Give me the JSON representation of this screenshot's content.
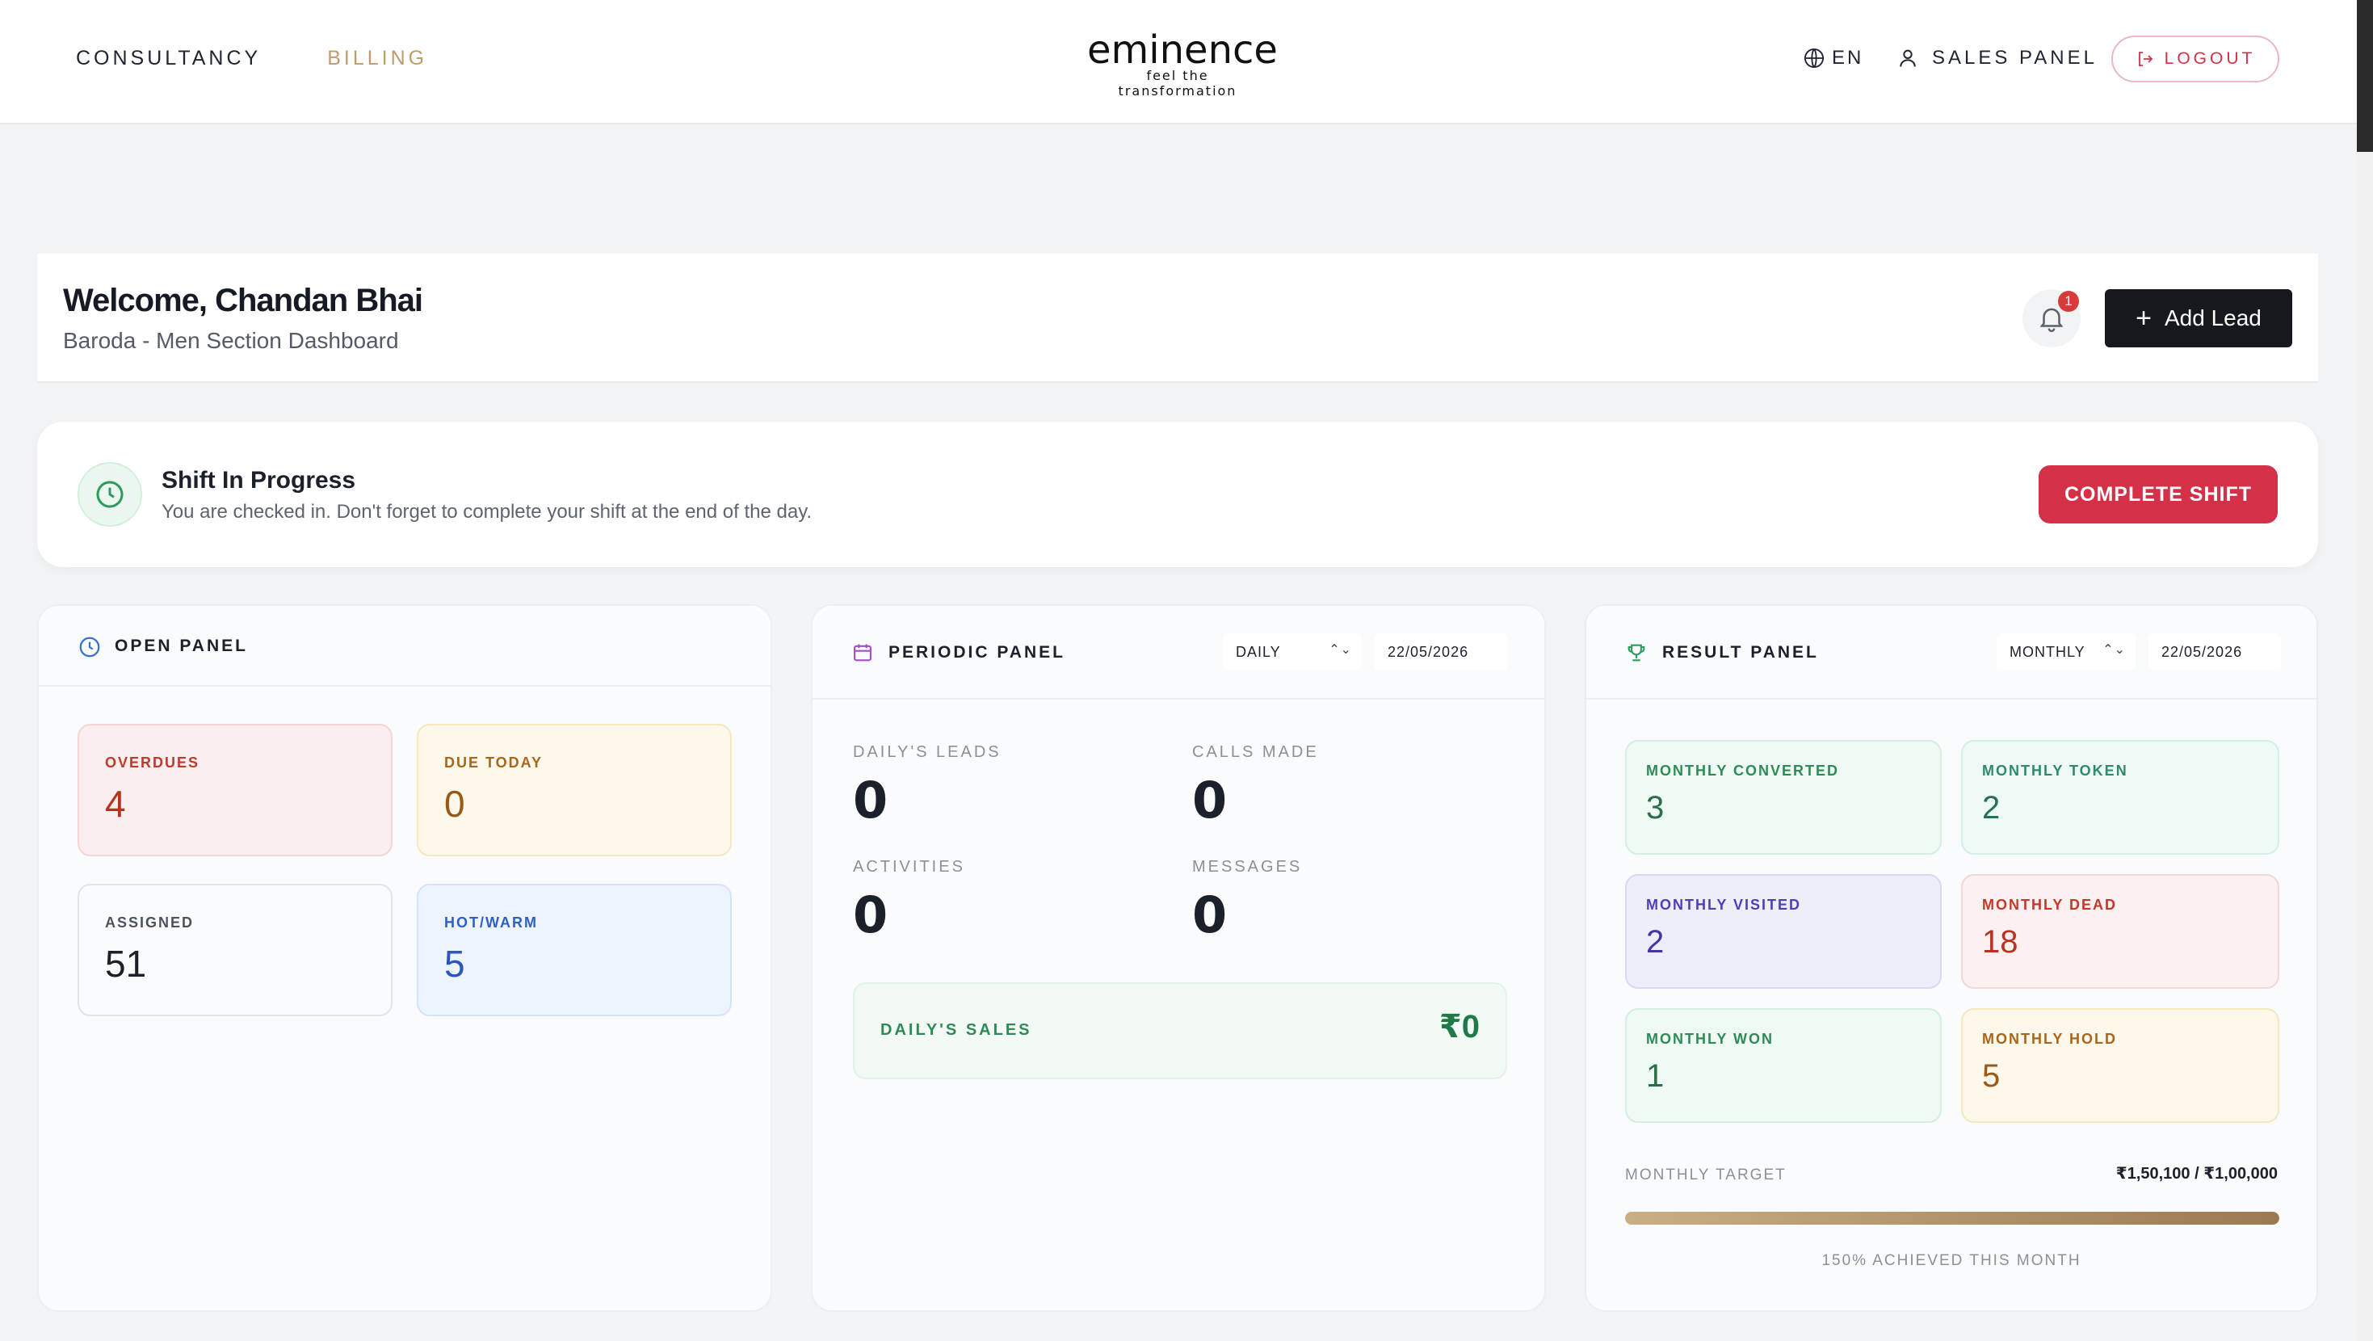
{
  "nav": {
    "links": [
      "CONSULTANCY",
      "BILLING"
    ],
    "brand_name": "eminence",
    "brand_tagline": "feel the transformation",
    "lang": "EN",
    "sales_panel": "SALES PANEL",
    "logout": "LOGOUT"
  },
  "welcome": {
    "title": "Welcome, Chandan Bhai",
    "subtitle": "Baroda - Men Section Dashboard",
    "notification_count": "1",
    "add_lead": "Add Lead"
  },
  "shift": {
    "title": "Shift In Progress",
    "message": "You are checked in. Don't forget to complete your shift at the end of the day.",
    "button": "COMPLETE SHIFT"
  },
  "open_panel": {
    "title": "OPEN PANEL",
    "cards": [
      {
        "label": "OVERDUES",
        "value": "4"
      },
      {
        "label": "DUE TODAY",
        "value": "0"
      },
      {
        "label": "ASSIGNED",
        "value": "51"
      },
      {
        "label": "HOT/WARM",
        "value": "5"
      }
    ]
  },
  "periodic_panel": {
    "title": "PERIODIC PANEL",
    "period": "DAILY",
    "date": "22/05/2026",
    "stats": [
      {
        "label": "DAILY'S LEADS",
        "value": "0"
      },
      {
        "label": "CALLS MADE",
        "value": "0"
      },
      {
        "label": "ACTIVITIES",
        "value": "0"
      },
      {
        "label": "MESSAGES",
        "value": "0"
      }
    ],
    "sales_label": "DAILY'S SALES",
    "sales_value": "₹0"
  },
  "result_panel": {
    "title": "RESULT PANEL",
    "period": "MONTHLY",
    "date": "22/05/2026",
    "cards": [
      {
        "label": "MONTHLY CONVERTED",
        "value": "3"
      },
      {
        "label": "MONTHLY TOKEN",
        "value": "2"
      },
      {
        "label": "MONTHLY VISITED",
        "value": "2"
      },
      {
        "label": "MONTHLY DEAD",
        "value": "18"
      },
      {
        "label": "MONTHLY WON",
        "value": "1"
      },
      {
        "label": "MONTHLY HOLD",
        "value": "5"
      }
    ],
    "target_label": "MONTHLY TARGET",
    "target_value": "₹1,50,100 / ₹1,00,000",
    "target_progress": 1.0,
    "achieved_text": "150% ACHIEVED THIS MONTH"
  },
  "colors": {
    "accent_billing": "#c29a6c",
    "danger": "#d43048",
    "dark_button": "#16181d"
  }
}
